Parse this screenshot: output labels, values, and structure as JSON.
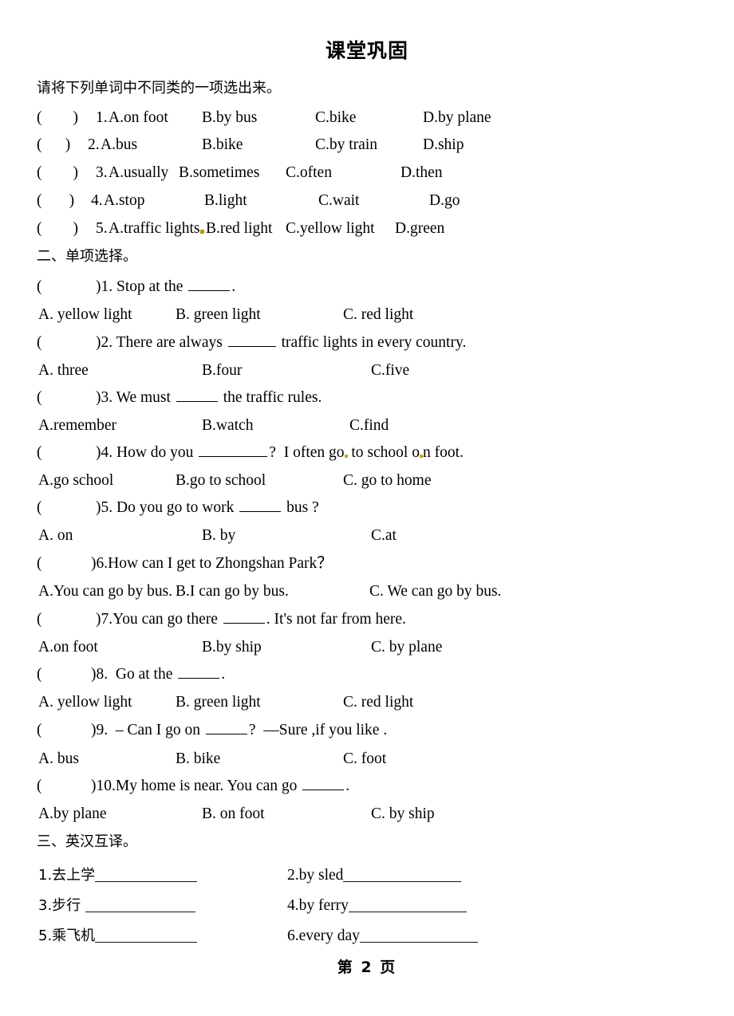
{
  "document": {
    "title": "课堂巩固",
    "footer": "第 2 页"
  },
  "section1": {
    "instruction": "请将下列单词中不同类的一项选出来。",
    "questions": [
      {
        "bracket": "(",
        "close": ")",
        "number": "1.",
        "a": "A.on foot",
        "b": "B.by bus",
        "c": "C.bike",
        "d": "D.by plane"
      },
      {
        "bracket": "(",
        "close": ")",
        "number": "2.",
        "a": "A.bus",
        "b": "B.bike",
        "c": "C.by train",
        "d": "D.ship"
      },
      {
        "bracket": "(",
        "close": ")",
        "number": "3.",
        "a": "A.usually",
        "b": "B.sometimes",
        "c": "C.often",
        "d": "D.then"
      },
      {
        "bracket": "(",
        "close": ")",
        "number": "4.",
        "a": "A.stop",
        "b": "B.light",
        "c": "C.wait",
        "d": "D.go"
      },
      {
        "bracket": "(",
        "close": ")",
        "number": "5.",
        "a": "A.traffic lights",
        "b": "B.red light",
        "c": "C.yellow light",
        "d": "D.green"
      }
    ]
  },
  "section2": {
    "heading": "二、单项选择。",
    "q1": {
      "stem_pre": ")1. Stop at the ",
      "stem_post": ".",
      "a": "A. yellow light",
      "b": "B. green light",
      "c": "C. red light"
    },
    "q2": {
      "stem_pre": ")2. There are always ",
      "stem_post": " traffic lights in every country.",
      "a": "A. three",
      "b": "B.four",
      "c": "C.five"
    },
    "q3": {
      "stem_pre": ")3. We must ",
      "stem_post": " the traffic rules.",
      "a": "A.remember",
      "b": "B.watch",
      "c": "C.find"
    },
    "q4": {
      "stem_pre": ")4. How do you ",
      "stem_post": "?  I often go",
      "stem_tail": " to school o",
      "stem_tail2": "n foot.",
      "a": "A.go school",
      "b": "B.go to school",
      "c": "C. go to home"
    },
    "q5": {
      "stem_pre": ")5. Do you go to work ",
      "stem_post": " bus ?",
      "a": "A. on",
      "b": "B. by",
      "c": "C.at"
    },
    "q6": {
      "stem": ")6.How can I get to Zhongshan Park？",
      "a": "A.You can go by bus.",
      "b": "B.I can go by bus.",
      "c": "C. We can go by bus."
    },
    "q7": {
      "stem_pre": ")7.You can go there ",
      "stem_post": ". It's not far from here.",
      "a": "A.on foot",
      "b": "B.by ship",
      "c": "C. by plane"
    },
    "q8": {
      "stem_pre": ")8.  Go at the ",
      "stem_post": ".",
      "a": "A. yellow light",
      "b": "B. green light",
      "c": "C. red light"
    },
    "q9": {
      "stem_pre": ")9.  – Can I go on ",
      "stem_post": "?  —Sure ,if you like .",
      "a": "A. bus",
      "b": "B. bike",
      "c": "C. foot"
    },
    "q10": {
      "stem_pre": ")10.My home is near. You can go ",
      "stem_post": ".",
      "a": "A.by plane",
      "b": "B. on foot",
      "c": "C. by ship"
    },
    "bracket_open": "(",
    "bracket_gap": "       "
  },
  "section3": {
    "heading": "三、英汉互译。",
    "items": [
      {
        "label": "1.去上学"
      },
      {
        "label": "2.by sled"
      },
      {
        "label": "3.步行 "
      },
      {
        "label": "4.by ferry"
      },
      {
        "label": "5.乘飞机"
      },
      {
        "label": "6.every day"
      }
    ]
  }
}
